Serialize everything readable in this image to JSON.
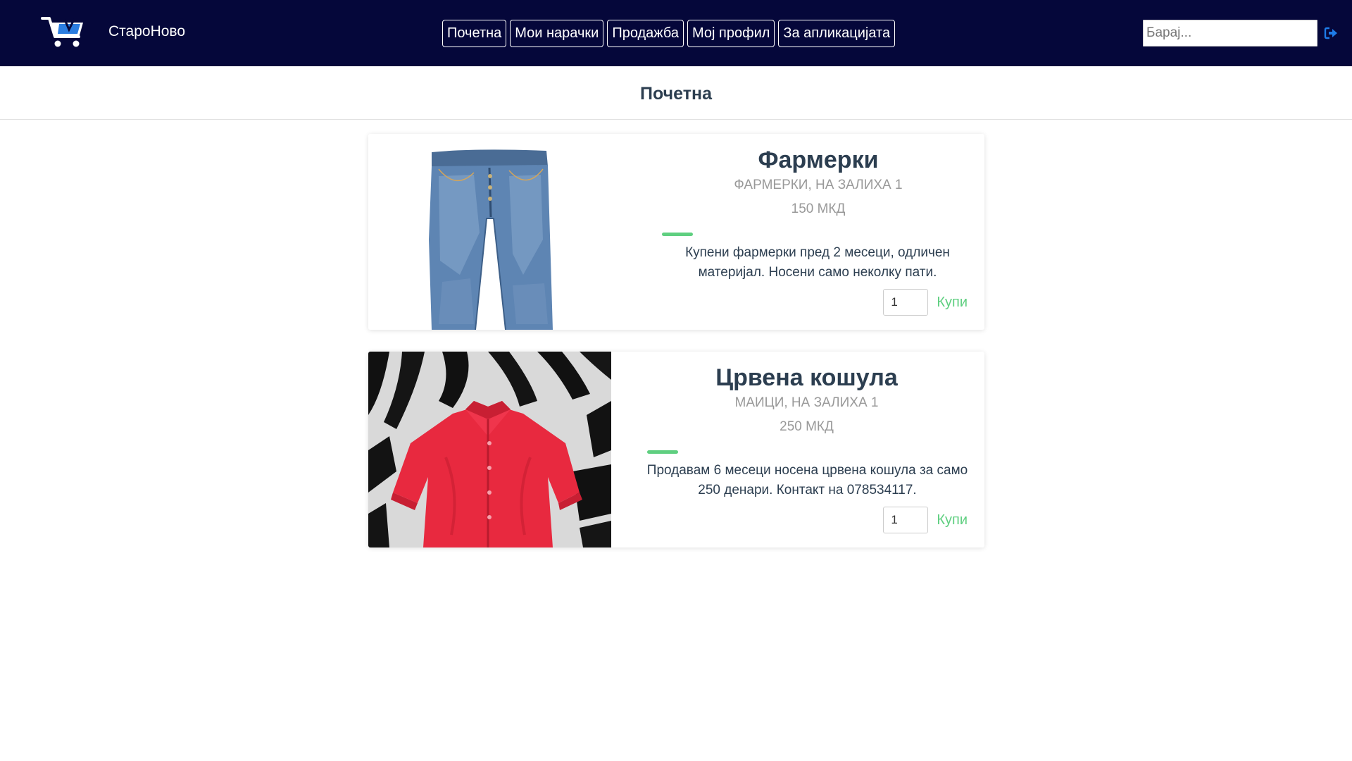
{
  "header": {
    "brand": "СтароНово",
    "nav": [
      {
        "label": "Почетна"
      },
      {
        "label": "Мои нарачки"
      },
      {
        "label": "Продажба"
      },
      {
        "label": "Мој профил"
      },
      {
        "label": "За апликацијата"
      }
    ],
    "search": {
      "placeholder": "Барај...",
      "value": ""
    }
  },
  "page": {
    "title": "Почетна"
  },
  "products": [
    {
      "name": "Фармерки",
      "meta": "ФАРМЕРКИ, НА ЗАЛИХА 1",
      "price": "150 МКД",
      "description": "Купени фармерки пред 2 месеци, одличен материјал. Носени само неколку пати.",
      "quantity": "1",
      "buy_label": "Купи",
      "image_icon": "jeans-photo"
    },
    {
      "name": "Црвена кошула",
      "meta": "МАИЦИ, НА ЗАЛИХА 1",
      "price": "250 МКД",
      "description": "Продавам 6 месеци носена црвена кошула за само 250 денари. Контакт на 078534117.",
      "quantity": "1",
      "buy_label": "Купи",
      "image_icon": "red-shirt-photo"
    }
  ],
  "colors": {
    "navbar_bg": "#05073a",
    "accent": "#5fcf80",
    "muted_text": "#999999",
    "body_text": "#2c3e50"
  }
}
